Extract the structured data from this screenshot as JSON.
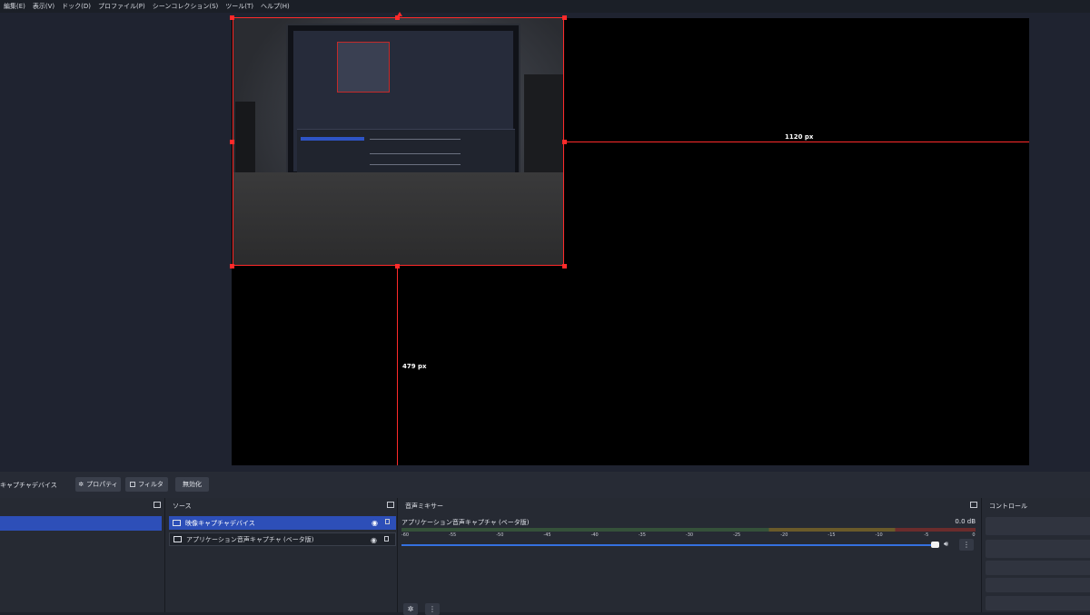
{
  "menubar": {
    "items": [
      {
        "label": "編集(E)"
      },
      {
        "label": "表示(V)"
      },
      {
        "label": "ドック(D)"
      },
      {
        "label": "プロファイル(P)"
      },
      {
        "label": "シーンコレクション(S)"
      },
      {
        "label": "ツール(T)"
      },
      {
        "label": "ヘルプ(H)"
      }
    ]
  },
  "preview": {
    "width_label": "1120 px",
    "height_label": "479 px"
  },
  "source_toolbar": {
    "selected_source": "キャプチャデバイス",
    "properties_label": "プロパティ",
    "filters_label": "フィルタ",
    "disable_label": "無効化"
  },
  "sources": {
    "title": "ソース",
    "items": [
      {
        "label": "映像キャプチャデバイス"
      },
      {
        "label": "アプリケーション音声キャプチャ (ベータ版)"
      }
    ]
  },
  "mixer": {
    "title": "音声ミキサー",
    "channel_label": "アプリケーション音声キャプチャ (ベータ版)",
    "db_value": "0.0 dB",
    "ticks": [
      "-60",
      "-55",
      "-50",
      "-45",
      "-40",
      "-35",
      "-30",
      "-25",
      "-20",
      "-15",
      "-10",
      "-5",
      "0"
    ]
  },
  "controls": {
    "title": "コントロール"
  },
  "colors": {
    "accent": "#2d4fb8",
    "guide": "#ff2a2a",
    "background": "#1e222b"
  }
}
